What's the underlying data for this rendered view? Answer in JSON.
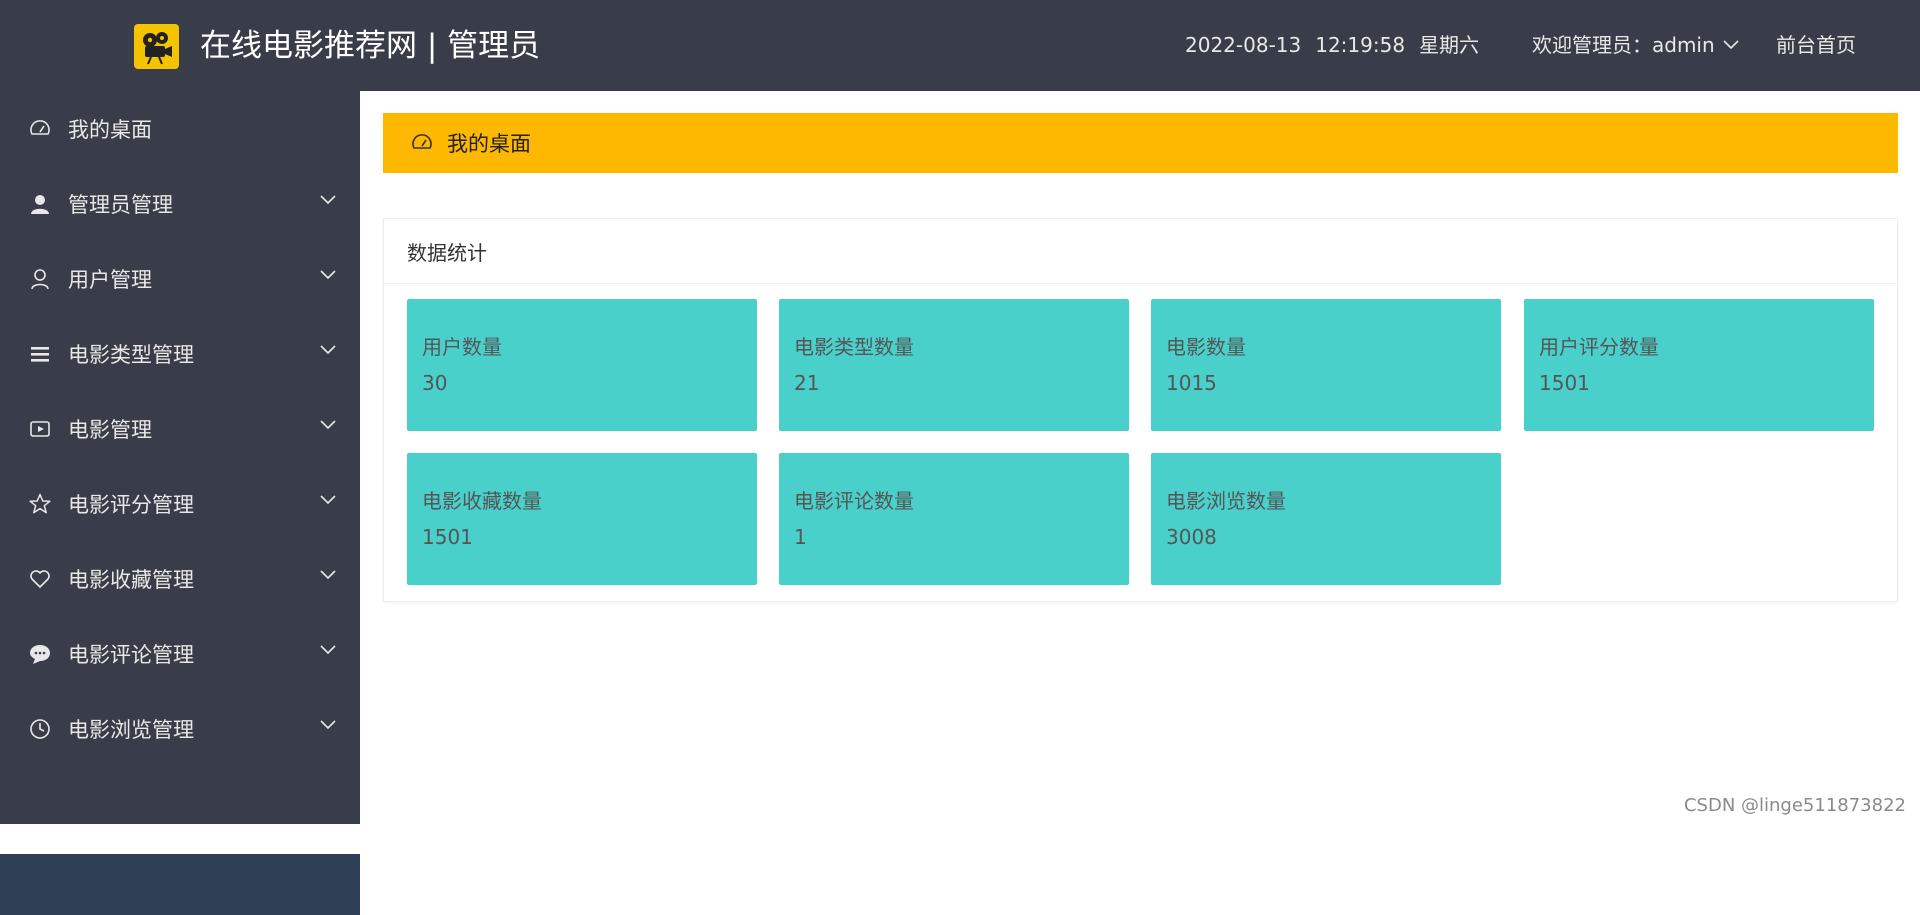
{
  "header": {
    "title": "在线电影推荐网 | 管理员",
    "date": "2022-08-13",
    "time": "12:19:58",
    "weekday": "星期六",
    "welcome": "欢迎管理员：admin",
    "home_link": "前台首页",
    "background": "#393d49",
    "logo_color": "#f5c400"
  },
  "sidebar": {
    "background": "#393d49",
    "items": [
      {
        "label": "我的桌面",
        "icon": "dashboard-icon",
        "expandable": false
      },
      {
        "label": "管理员管理",
        "icon": "user-solid-icon",
        "expandable": true
      },
      {
        "label": "用户管理",
        "icon": "user-outline-icon",
        "expandable": true
      },
      {
        "label": "电影类型管理",
        "icon": "list-icon",
        "expandable": true
      },
      {
        "label": "电影管理",
        "icon": "video-icon",
        "expandable": true
      },
      {
        "label": "电影评分管理",
        "icon": "star-icon",
        "expandable": true
      },
      {
        "label": "电影收藏管理",
        "icon": "heart-icon",
        "expandable": true
      },
      {
        "label": "电影评论管理",
        "icon": "comment-icon",
        "expandable": true
      },
      {
        "label": "电影浏览管理",
        "icon": "clock-icon",
        "expandable": true
      }
    ]
  },
  "main": {
    "banner_title": "我的桌面",
    "banner_color": "#ffb800",
    "stats_title": "数据统计",
    "tile_color": "#4ad0cb",
    "stats": [
      {
        "label": "用户数量",
        "value": "30"
      },
      {
        "label": "电影类型数量",
        "value": "21"
      },
      {
        "label": "电影数量",
        "value": "1015"
      },
      {
        "label": "用户评分数量",
        "value": "1501"
      },
      {
        "label": "电影收藏数量",
        "value": "1501"
      },
      {
        "label": "电影评论数量",
        "value": "1"
      },
      {
        "label": "电影浏览数量",
        "value": "3008"
      }
    ]
  },
  "watermark": "CSDN @linge511873822"
}
